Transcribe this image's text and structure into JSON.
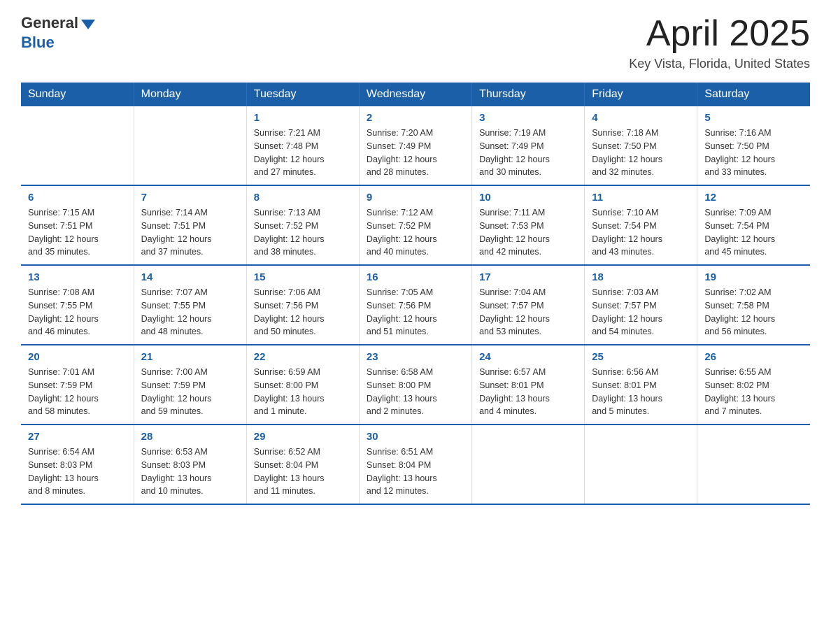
{
  "header": {
    "logo_general": "General",
    "logo_blue": "Blue",
    "month_title": "April 2025",
    "location": "Key Vista, Florida, United States"
  },
  "weekdays": [
    "Sunday",
    "Monday",
    "Tuesday",
    "Wednesday",
    "Thursday",
    "Friday",
    "Saturday"
  ],
  "weeks": [
    [
      {
        "day": "",
        "info": ""
      },
      {
        "day": "",
        "info": ""
      },
      {
        "day": "1",
        "info": "Sunrise: 7:21 AM\nSunset: 7:48 PM\nDaylight: 12 hours\nand 27 minutes."
      },
      {
        "day": "2",
        "info": "Sunrise: 7:20 AM\nSunset: 7:49 PM\nDaylight: 12 hours\nand 28 minutes."
      },
      {
        "day": "3",
        "info": "Sunrise: 7:19 AM\nSunset: 7:49 PM\nDaylight: 12 hours\nand 30 minutes."
      },
      {
        "day": "4",
        "info": "Sunrise: 7:18 AM\nSunset: 7:50 PM\nDaylight: 12 hours\nand 32 minutes."
      },
      {
        "day": "5",
        "info": "Sunrise: 7:16 AM\nSunset: 7:50 PM\nDaylight: 12 hours\nand 33 minutes."
      }
    ],
    [
      {
        "day": "6",
        "info": "Sunrise: 7:15 AM\nSunset: 7:51 PM\nDaylight: 12 hours\nand 35 minutes."
      },
      {
        "day": "7",
        "info": "Sunrise: 7:14 AM\nSunset: 7:51 PM\nDaylight: 12 hours\nand 37 minutes."
      },
      {
        "day": "8",
        "info": "Sunrise: 7:13 AM\nSunset: 7:52 PM\nDaylight: 12 hours\nand 38 minutes."
      },
      {
        "day": "9",
        "info": "Sunrise: 7:12 AM\nSunset: 7:52 PM\nDaylight: 12 hours\nand 40 minutes."
      },
      {
        "day": "10",
        "info": "Sunrise: 7:11 AM\nSunset: 7:53 PM\nDaylight: 12 hours\nand 42 minutes."
      },
      {
        "day": "11",
        "info": "Sunrise: 7:10 AM\nSunset: 7:54 PM\nDaylight: 12 hours\nand 43 minutes."
      },
      {
        "day": "12",
        "info": "Sunrise: 7:09 AM\nSunset: 7:54 PM\nDaylight: 12 hours\nand 45 minutes."
      }
    ],
    [
      {
        "day": "13",
        "info": "Sunrise: 7:08 AM\nSunset: 7:55 PM\nDaylight: 12 hours\nand 46 minutes."
      },
      {
        "day": "14",
        "info": "Sunrise: 7:07 AM\nSunset: 7:55 PM\nDaylight: 12 hours\nand 48 minutes."
      },
      {
        "day": "15",
        "info": "Sunrise: 7:06 AM\nSunset: 7:56 PM\nDaylight: 12 hours\nand 50 minutes."
      },
      {
        "day": "16",
        "info": "Sunrise: 7:05 AM\nSunset: 7:56 PM\nDaylight: 12 hours\nand 51 minutes."
      },
      {
        "day": "17",
        "info": "Sunrise: 7:04 AM\nSunset: 7:57 PM\nDaylight: 12 hours\nand 53 minutes."
      },
      {
        "day": "18",
        "info": "Sunrise: 7:03 AM\nSunset: 7:57 PM\nDaylight: 12 hours\nand 54 minutes."
      },
      {
        "day": "19",
        "info": "Sunrise: 7:02 AM\nSunset: 7:58 PM\nDaylight: 12 hours\nand 56 minutes."
      }
    ],
    [
      {
        "day": "20",
        "info": "Sunrise: 7:01 AM\nSunset: 7:59 PM\nDaylight: 12 hours\nand 58 minutes."
      },
      {
        "day": "21",
        "info": "Sunrise: 7:00 AM\nSunset: 7:59 PM\nDaylight: 12 hours\nand 59 minutes."
      },
      {
        "day": "22",
        "info": "Sunrise: 6:59 AM\nSunset: 8:00 PM\nDaylight: 13 hours\nand 1 minute."
      },
      {
        "day": "23",
        "info": "Sunrise: 6:58 AM\nSunset: 8:00 PM\nDaylight: 13 hours\nand 2 minutes."
      },
      {
        "day": "24",
        "info": "Sunrise: 6:57 AM\nSunset: 8:01 PM\nDaylight: 13 hours\nand 4 minutes."
      },
      {
        "day": "25",
        "info": "Sunrise: 6:56 AM\nSunset: 8:01 PM\nDaylight: 13 hours\nand 5 minutes."
      },
      {
        "day": "26",
        "info": "Sunrise: 6:55 AM\nSunset: 8:02 PM\nDaylight: 13 hours\nand 7 minutes."
      }
    ],
    [
      {
        "day": "27",
        "info": "Sunrise: 6:54 AM\nSunset: 8:03 PM\nDaylight: 13 hours\nand 8 minutes."
      },
      {
        "day": "28",
        "info": "Sunrise: 6:53 AM\nSunset: 8:03 PM\nDaylight: 13 hours\nand 10 minutes."
      },
      {
        "day": "29",
        "info": "Sunrise: 6:52 AM\nSunset: 8:04 PM\nDaylight: 13 hours\nand 11 minutes."
      },
      {
        "day": "30",
        "info": "Sunrise: 6:51 AM\nSunset: 8:04 PM\nDaylight: 13 hours\nand 12 minutes."
      },
      {
        "day": "",
        "info": ""
      },
      {
        "day": "",
        "info": ""
      },
      {
        "day": "",
        "info": ""
      }
    ]
  ]
}
